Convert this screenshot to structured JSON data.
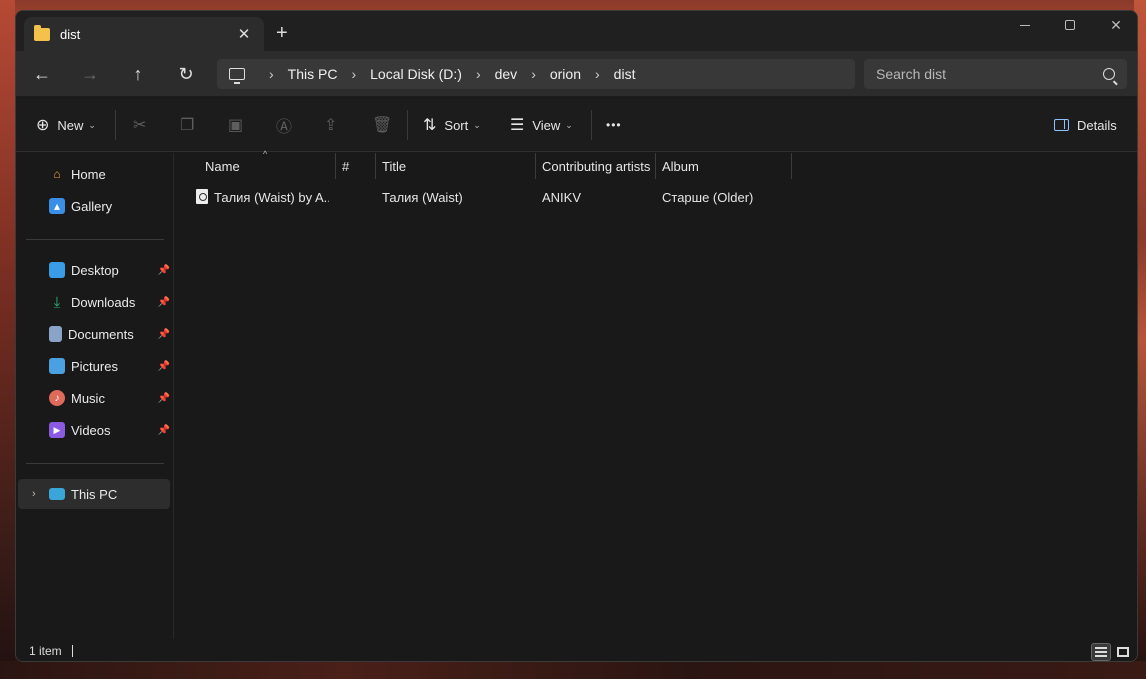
{
  "window": {
    "tab_title": "dist",
    "tab_close": "✕",
    "new_tab": "+",
    "minimize": "",
    "maximize": "",
    "close": "✕"
  },
  "nav": {
    "back_icon": "←",
    "forward_icon": "→",
    "up_icon": "↑",
    "refresh_icon": "↻",
    "breadcrumb": [
      "This PC",
      "Local Disk (D:)",
      "dev",
      "orion",
      "dist"
    ],
    "separator": "›",
    "search_placeholder": "Search dist"
  },
  "toolbar": {
    "new_label": "New",
    "sort_label": "Sort",
    "view_label": "View",
    "more_label": "•••",
    "details_label": "Details",
    "cut_icon": "scissors-icon",
    "copy_icon": "copy-icon",
    "paste_icon": "paste-icon",
    "rename_icon": "rename-icon",
    "share_icon": "share-icon",
    "delete_icon": "trash-icon"
  },
  "sidebar": {
    "quick": [
      {
        "label": "Home",
        "icon": "home-icon",
        "color": "#f2a33a"
      },
      {
        "label": "Gallery",
        "icon": "gallery-icon",
        "color": "#3a8ee6"
      }
    ],
    "pinned": [
      {
        "label": "Desktop",
        "icon": "desktop-icon",
        "color": "#3a9be6"
      },
      {
        "label": "Downloads",
        "icon": "downloads-icon",
        "color": "#2fb47a"
      },
      {
        "label": "Documents",
        "icon": "documents-icon",
        "color": "#8aa4c8"
      },
      {
        "label": "Pictures",
        "icon": "pictures-icon",
        "color": "#4aa0e0"
      },
      {
        "label": "Music",
        "icon": "music-icon",
        "color": "#e06a5a"
      },
      {
        "label": "Videos",
        "icon": "videos-icon",
        "color": "#8a5ae0"
      }
    ],
    "this_pc": "This PC",
    "pin_glyph": "📌"
  },
  "columns": [
    "Name",
    "#",
    "Title",
    "Contributing artists",
    "Album"
  ],
  "files": [
    {
      "name": "Талия (Waist) by A...",
      "track": "",
      "title": "Талия (Waist)",
      "artists": "ANIKV",
      "album": "Старше (Older)"
    }
  ],
  "status": {
    "count": "1 item"
  }
}
